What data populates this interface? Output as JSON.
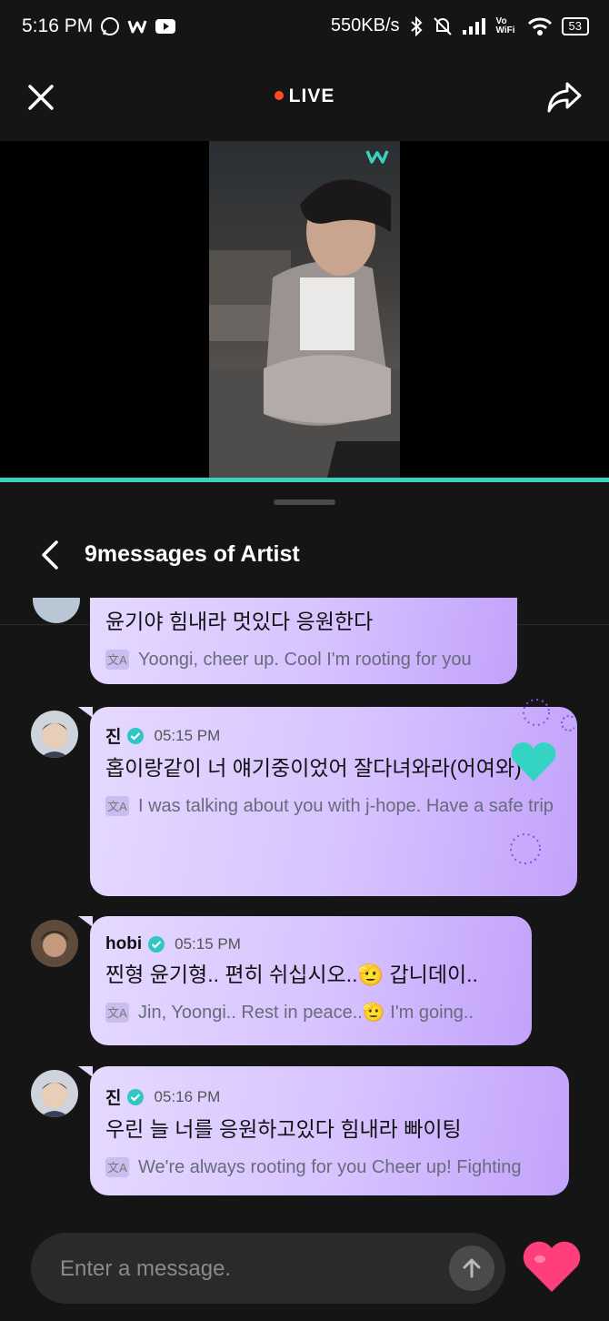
{
  "status_bar": {
    "time": "5:16 PM",
    "net_speed": "550KB/s",
    "battery": "53",
    "vo_wifi": "Vo WiFi"
  },
  "header": {
    "live_label": "LIVE"
  },
  "panel": {
    "title": "9messages of Artist"
  },
  "messages": [
    {
      "text": "윤기야 힘내라 멋있다 응원한다",
      "translation": "Yoongi, cheer up. Cool I'm rooting for you"
    },
    {
      "name": "진",
      "time": "05:15 PM",
      "text": "홉이랑같이 너 얘기중이었어 잘다녀와라(어여와)",
      "translation": "I was talking about you with j-hope. Have a safe trip"
    },
    {
      "name": "hobi",
      "time": "05:15 PM",
      "text": "찐형 윤기형.. 편히 쉬십시오..🫡 갑니데이..",
      "translation": "Jin, Yoongi.. Rest in peace..🫡 I'm going.."
    },
    {
      "name": "진",
      "time": "05:16 PM",
      "text": "우린 늘 너를 응원하고있다 힘내라 빠이팅",
      "translation": "We're always rooting for you Cheer up! Fighting"
    }
  ],
  "input": {
    "placeholder": "Enter a message."
  },
  "colors": {
    "accent": "#3ad0c2",
    "live_dot": "#ff4b1f",
    "heart": "#ff3f7c",
    "bubble": "#d7c2ff"
  }
}
